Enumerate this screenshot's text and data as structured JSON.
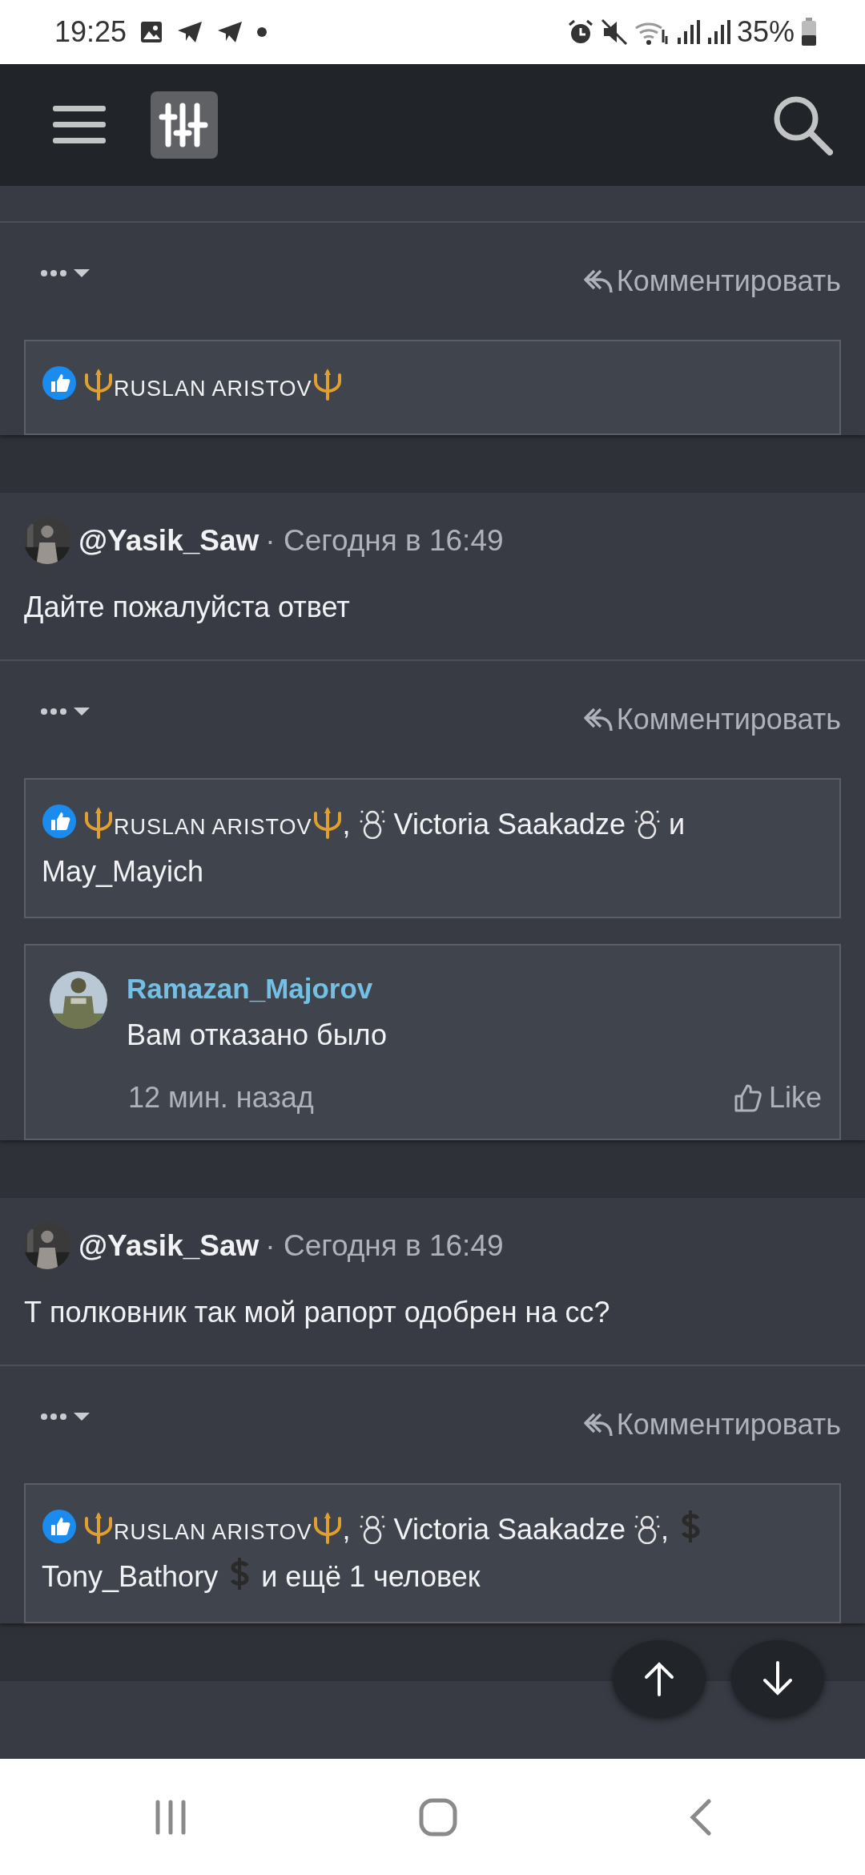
{
  "status_bar": {
    "time": "19:25",
    "battery": "35%"
  },
  "posts": [
    {
      "comment_label": "Комментировать",
      "likes": [
        {
          "kind": "trident"
        },
        {
          "kind": "smallcaps",
          "text": "RUSLAN ARISTOV"
        },
        {
          "kind": "trident"
        }
      ]
    },
    {
      "author": "@Yasik_Saw",
      "time": "· Сегодня в 16:49",
      "text": "Дайте пожалуйста ответ",
      "comment_label": "Комментировать",
      "likes": [
        {
          "kind": "trident"
        },
        {
          "kind": "smallcaps",
          "text": "RUSLAN ARISTOV"
        },
        {
          "kind": "trident"
        },
        {
          "kind": "text",
          "text": ", "
        },
        {
          "kind": "snowman"
        },
        {
          "kind": "text",
          "text": " Victoria Saakadze "
        },
        {
          "kind": "snowman"
        },
        {
          "kind": "text",
          "text": " и "
        },
        {
          "kind": "text",
          "text": "May_Mayich"
        }
      ],
      "comments": [
        {
          "author": "Ramazan_Majorov",
          "text": "Вам отказано было",
          "time": "12 мин. назад",
          "like_label": "Like"
        }
      ]
    },
    {
      "author": "@Yasik_Saw",
      "time": "· Сегодня в 16:49",
      "text": "Т полковник так мой рапорт одобрен на сс?",
      "comment_label": "Комментировать",
      "likes": [
        {
          "kind": "trident"
        },
        {
          "kind": "smallcaps",
          "text": "RUSLAN ARISTOV"
        },
        {
          "kind": "trident"
        },
        {
          "kind": "text",
          "text": ", "
        },
        {
          "kind": "snowman"
        },
        {
          "kind": "text",
          "text": " Victoria Saakadze "
        },
        {
          "kind": "snowman"
        },
        {
          "kind": "text",
          "text": ", "
        },
        {
          "kind": "dollar"
        },
        {
          "kind": "text",
          "text": "Tony_Bathory "
        },
        {
          "kind": "dollar"
        },
        {
          "kind": "text",
          "text": " и ещё 1 человек"
        }
      ]
    }
  ]
}
